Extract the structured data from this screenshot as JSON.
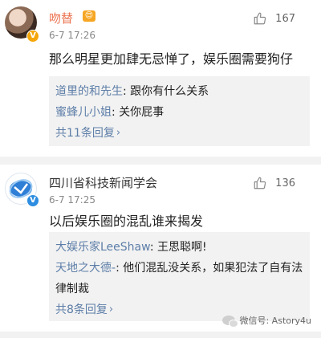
{
  "comments": [
    {
      "user": "吻替",
      "user_badge": "😍",
      "verified_color": "#f4a60a",
      "time": "6-7 17:26",
      "likes": "167",
      "text": "那么明星更加肆无忌惮了，娱乐圈需要狗仔",
      "replies": [
        {
          "name": "道里的和先生",
          "text": ": 跟你有什么关系"
        },
        {
          "name": "蜜蜂儿小姐",
          "text": ": 关你屁事"
        }
      ],
      "more": "共11条回复"
    },
    {
      "user": "四川省科技新闻学会",
      "verified_color": "#2d8de0",
      "time": "6-7 17:25",
      "likes": "136",
      "text": "以后娱乐圈的混乱谁来揭发",
      "replies": [
        {
          "name": "大娱乐家LeeShaw",
          "text": ": 王思聪啊!"
        },
        {
          "name": "天地之大德-",
          "text": ": 他们混乱没关系，如果犯法了自有法律制裁"
        }
      ],
      "more": "共8条回复"
    }
  ],
  "watermark": "微信号: Astory4u",
  "colors": {
    "name_highlight": "#eb7350",
    "link_blue": "#5d7ea8",
    "reply_bg": "#f2f2f2"
  },
  "icons": {
    "like": "thumbs-up-icon",
    "more": "chevron-right-icon"
  }
}
